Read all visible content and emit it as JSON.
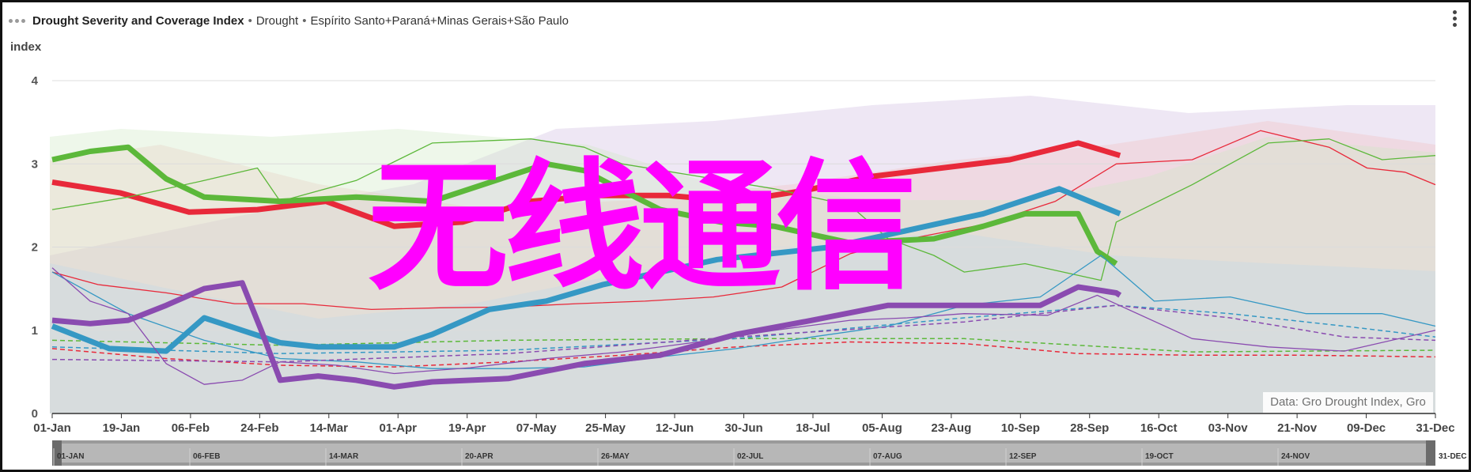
{
  "header": {
    "title": "Drought Severity and Coverage Index",
    "item": "Drought",
    "regions": "Espírito Santo+Paraná+Minas Gerais+São Paulo"
  },
  "watermark": "无线通信",
  "credit": "Data: Gro Drought Index, Gro",
  "navigator": {
    "labels": [
      "01-JAN",
      "06-FEB",
      "14-MAR",
      "20-APR",
      "26-MAY",
      "02-JUL",
      "07-AUG",
      "12-SEP",
      "19-OCT",
      "24-NOV",
      "31-DEC"
    ]
  },
  "chart_data": {
    "type": "line",
    "ylabel": "index",
    "ylim": [
      0,
      4
    ],
    "yticks": [
      0,
      1,
      2,
      3,
      4
    ],
    "xlim_day": [
      0,
      364
    ],
    "xtick_labels": [
      "01-Jan",
      "19-Jan",
      "06-Feb",
      "24-Feb",
      "14-Mar",
      "01-Apr",
      "19-Apr",
      "07-May",
      "25-May",
      "12-Jun",
      "30-Jun",
      "18-Jul",
      "05-Aug",
      "23-Aug",
      "10-Sep",
      "28-Sep",
      "16-Oct",
      "03-Nov",
      "21-Nov",
      "09-Dec",
      "31-Dec"
    ],
    "grid": true,
    "legend": "none",
    "series": [
      {
        "color": "#e8293a",
        "style": "thick",
        "x": [
          0,
          18,
          36,
          54,
          72,
          90,
          108,
          126,
          144,
          162,
          180,
          198,
          216,
          234,
          252,
          270,
          281
        ],
        "y": [
          2.78,
          2.65,
          2.42,
          2.45,
          2.55,
          2.25,
          2.3,
          2.55,
          2.62,
          2.62,
          2.55,
          2.68,
          2.85,
          2.95,
          3.05,
          3.25,
          3.1
        ]
      },
      {
        "color": "#e8293a",
        "style": "thin",
        "x": [
          0,
          12,
          30,
          48,
          66,
          84,
          102,
          120,
          138,
          156,
          174,
          192,
          210,
          228,
          246,
          264,
          280,
          300,
          318,
          336,
          346,
          356,
          364
        ],
        "y": [
          1.7,
          1.55,
          1.45,
          1.32,
          1.32,
          1.25,
          1.27,
          1.28,
          1.32,
          1.35,
          1.4,
          1.52,
          1.92,
          2.12,
          2.28,
          2.55,
          3.0,
          3.05,
          3.4,
          3.2,
          2.95,
          2.9,
          2.75
        ]
      },
      {
        "color": "#e8293a",
        "style": "dash",
        "x": [
          0,
          30,
          60,
          90,
          120,
          150,
          180,
          210,
          240,
          270,
          300,
          330,
          364
        ],
        "y": [
          0.78,
          0.66,
          0.58,
          0.56,
          0.62,
          0.7,
          0.8,
          0.86,
          0.84,
          0.72,
          0.7,
          0.7,
          0.68
        ]
      },
      {
        "color": "#5cb83a",
        "style": "thick",
        "x": [
          0,
          10,
          20,
          30,
          40,
          60,
          80,
          100,
          120,
          130,
          140,
          150,
          160,
          176,
          190,
          210,
          232,
          245,
          256,
          270,
          275,
          280
        ],
        "y": [
          3.05,
          3.15,
          3.2,
          2.82,
          2.6,
          2.55,
          2.6,
          2.55,
          2.85,
          3.0,
          2.92,
          2.68,
          2.45,
          2.3,
          2.25,
          2.05,
          2.1,
          2.25,
          2.4,
          2.4,
          1.95,
          1.8
        ]
      },
      {
        "color": "#5cb83a",
        "style": "thin",
        "x": [
          0,
          20,
          40,
          54,
          60,
          80,
          100,
          126,
          140,
          150,
          170,
          190,
          210,
          220,
          232,
          240,
          256,
          276,
          280,
          300,
          320,
          336,
          350,
          364
        ],
        "y": [
          2.45,
          2.6,
          2.8,
          2.95,
          2.55,
          2.8,
          3.25,
          3.3,
          3.2,
          3.0,
          2.85,
          2.7,
          2.5,
          2.1,
          1.9,
          1.7,
          1.8,
          1.6,
          2.3,
          2.75,
          3.25,
          3.3,
          3.05,
          3.1
        ]
      },
      {
        "color": "#5cb83a",
        "style": "dash",
        "x": [
          0,
          60,
          120,
          180,
          240,
          300,
          364
        ],
        "y": [
          0.88,
          0.82,
          0.88,
          0.9,
          0.9,
          0.74,
          0.76
        ]
      },
      {
        "color": "#3598c4",
        "style": "thick",
        "x": [
          0,
          15,
          30,
          40,
          50,
          60,
          70,
          80,
          90,
          100,
          115,
          130,
          145,
          160,
          175,
          185,
          195,
          205,
          215,
          230,
          245,
          255,
          265,
          281
        ],
        "y": [
          1.05,
          0.78,
          0.75,
          1.15,
          1.0,
          0.85,
          0.8,
          0.8,
          0.8,
          0.95,
          1.25,
          1.35,
          1.55,
          1.7,
          1.85,
          1.9,
          1.95,
          2.0,
          2.1,
          2.25,
          2.4,
          2.55,
          2.7,
          2.4
        ]
      },
      {
        "color": "#3598c4",
        "style": "thin",
        "x": [
          0,
          20,
          40,
          60,
          80,
          100,
          120,
          140,
          160,
          180,
          200,
          220,
          240,
          260,
          276,
          290,
          310,
          330,
          350,
          364
        ],
        "y": [
          1.7,
          1.2,
          0.88,
          0.66,
          0.62,
          0.54,
          0.54,
          0.56,
          0.68,
          0.78,
          0.92,
          1.05,
          1.3,
          1.4,
          1.9,
          1.35,
          1.4,
          1.2,
          1.2,
          1.05
        ]
      },
      {
        "color": "#3598c4",
        "style": "dash",
        "x": [
          0,
          60,
          120,
          180,
          240,
          280,
          310,
          340,
          364
        ],
        "y": [
          0.8,
          0.72,
          0.76,
          0.9,
          1.15,
          1.3,
          1.2,
          1.05,
          0.92
        ]
      },
      {
        "color": "#8a4bb0",
        "style": "thick",
        "x": [
          0,
          10,
          20,
          30,
          40,
          50,
          55,
          60,
          70,
          80,
          90,
          100,
          120,
          140,
          160,
          180,
          200,
          220,
          240,
          260,
          270,
          280,
          281
        ],
        "y": [
          1.12,
          1.08,
          1.12,
          1.3,
          1.5,
          1.57,
          1.0,
          0.4,
          0.45,
          0.4,
          0.32,
          0.38,
          0.42,
          0.6,
          0.7,
          0.95,
          1.12,
          1.3,
          1.3,
          1.3,
          1.52,
          1.45,
          1.42
        ]
      },
      {
        "color": "#8a4bb0",
        "style": "thin",
        "x": [
          0,
          10,
          20,
          30,
          40,
          50,
          60,
          75,
          90,
          110,
          130,
          150,
          170,
          190,
          210,
          225,
          240,
          262,
          275,
          300,
          320,
          340,
          364
        ],
        "y": [
          1.75,
          1.35,
          1.2,
          0.6,
          0.35,
          0.4,
          0.62,
          0.58,
          0.48,
          0.55,
          0.66,
          0.74,
          0.86,
          1.0,
          1.12,
          1.15,
          1.2,
          1.18,
          1.42,
          0.9,
          0.8,
          0.75,
          1.0
        ]
      },
      {
        "color": "#8a4bb0",
        "style": "dash",
        "x": [
          0,
          60,
          120,
          180,
          240,
          280,
          310,
          340,
          364
        ],
        "y": [
          0.65,
          0.62,
          0.72,
          0.92,
          1.1,
          1.3,
          1.15,
          0.92,
          0.88
        ]
      }
    ]
  }
}
